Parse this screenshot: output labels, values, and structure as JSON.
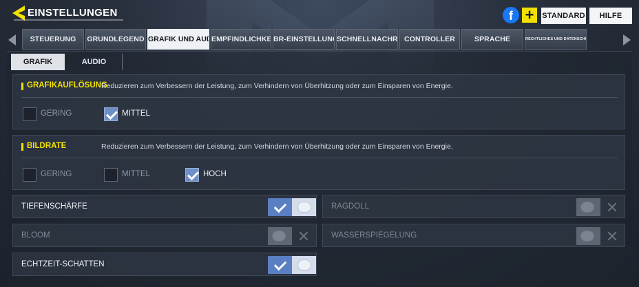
{
  "header": {
    "title": "EINSTELLUNGEN",
    "facebook_glyph": "f",
    "plus_glyph": "+",
    "standard_label": "STANDARD",
    "help_label": "HILFE"
  },
  "tabs": [
    {
      "label": "STEUERUNG"
    },
    {
      "label": "GRUNDLEGEND"
    },
    {
      "label": "GRAFIK UND AUDIO"
    },
    {
      "label": "EMPFINDLICHKEIT"
    },
    {
      "label": "BR-EINSTELLUNGEN"
    },
    {
      "label": "SCHNELLNACHRICHT"
    },
    {
      "label": "CONTROLLER"
    },
    {
      "label": "SPRACHE"
    },
    {
      "label": "RECHTLICHES UND DATENSCHUTZ"
    }
  ],
  "subtabs": {
    "grafik": "GRAFIK",
    "audio": "AUDIO"
  },
  "resolution": {
    "title": "GRAFIKAUFLÖSUNG",
    "description": "Reduzieren zum Verbessern der Leistung, zum Verhindern von Überhitzung oder zum Einsparen von Energie.",
    "options": [
      "GERING",
      "MITTEL"
    ],
    "selected": "MITTEL"
  },
  "framerate": {
    "title": "BILDRATE",
    "description": "Reduzieren zum Verbessern der Leistung, zum Verhindern von Überhitzung oder zum Einsparen von Energie.",
    "options": [
      "GERING",
      "MITTEL",
      "HOCH"
    ],
    "selected": "HOCH"
  },
  "toggles": {
    "depth_of_field": {
      "label": "TIEFENSCHÄRFE",
      "on": true
    },
    "ragdoll": {
      "label": "RAGDOLL",
      "on": false
    },
    "bloom": {
      "label": "BLOOM",
      "on": false
    },
    "water_reflection": {
      "label": "WASSERSPIEGELUNG",
      "on": false
    },
    "realtime_shadows": {
      "label": "ECHTZEIT-SCHATTEN",
      "on": true
    }
  },
  "colors": {
    "accent_yellow": "#f2e100",
    "toggle_on_blue": "#5a7fc2",
    "facebook_blue": "#1877f2"
  }
}
